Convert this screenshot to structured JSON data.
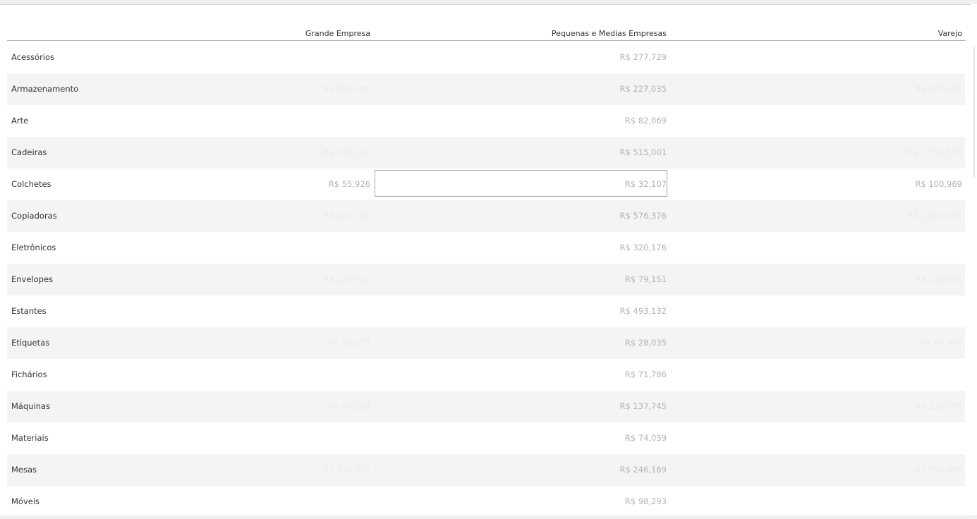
{
  "columns": [
    "Grande Empresa",
    "Pequenas e Medias Empresas",
    "Varejo"
  ],
  "rows": [
    {
      "label": "Acessórios",
      "grande": "",
      "pequenas": "R$ 277,729",
      "varejo": ""
    },
    {
      "label": "Armazenamento",
      "grande": "R$ 398,685",
      "pequenas": "R$ 227,035",
      "varejo": "R$ 904,642"
    },
    {
      "label": "Arte",
      "grande": "",
      "pequenas": "R$ 82,069",
      "varejo": ""
    },
    {
      "label": "Cadeiras",
      "grande": "R$ 841,336",
      "pequenas": "R$ 515,001",
      "varejo": "R$ 1,559,576"
    },
    {
      "label": "Colchetes",
      "grande": "R$ 55,926",
      "pequenas": "R$ 32,107",
      "varejo": "R$ 100,969"
    },
    {
      "label": "Copiadoras",
      "grande": "R$ 945,783",
      "pequenas": "R$ 576,376",
      "varejo": "R$ 1,631,939"
    },
    {
      "label": "Eletrônicos",
      "grande": "",
      "pequenas": "R$ 320,176",
      "varejo": ""
    },
    {
      "label": "Envelopes",
      "grande": "R$ 129,910",
      "pequenas": "R$ 79,151",
      "varejo": "R$ 232,002"
    },
    {
      "label": "Estantes",
      "grande": "",
      "pequenas": "R$ 493,132",
      "varejo": ""
    },
    {
      "label": "Etiquetas",
      "grande": "R$ 38,673",
      "pequenas": "R$ 28,035",
      "varejo": "R$ 69,919"
    },
    {
      "label": "Fichários",
      "grande": "",
      "pequenas": "R$ 71,786",
      "varejo": ""
    },
    {
      "label": "Máquinas",
      "grande": "R$ 45,263",
      "pequenas": "R$ 137,745",
      "varejo": "R$ 216,798"
    },
    {
      "label": "Materiais",
      "grande": "",
      "pequenas": "R$ 74,039",
      "varejo": ""
    },
    {
      "label": "Mesas",
      "grande": "R$ 351,037",
      "pequenas": "R$ 246,169",
      "varejo": "R$ 755,056"
    },
    {
      "label": "Móveis",
      "grande": "",
      "pequenas": "R$ 98,293",
      "varejo": ""
    }
  ]
}
